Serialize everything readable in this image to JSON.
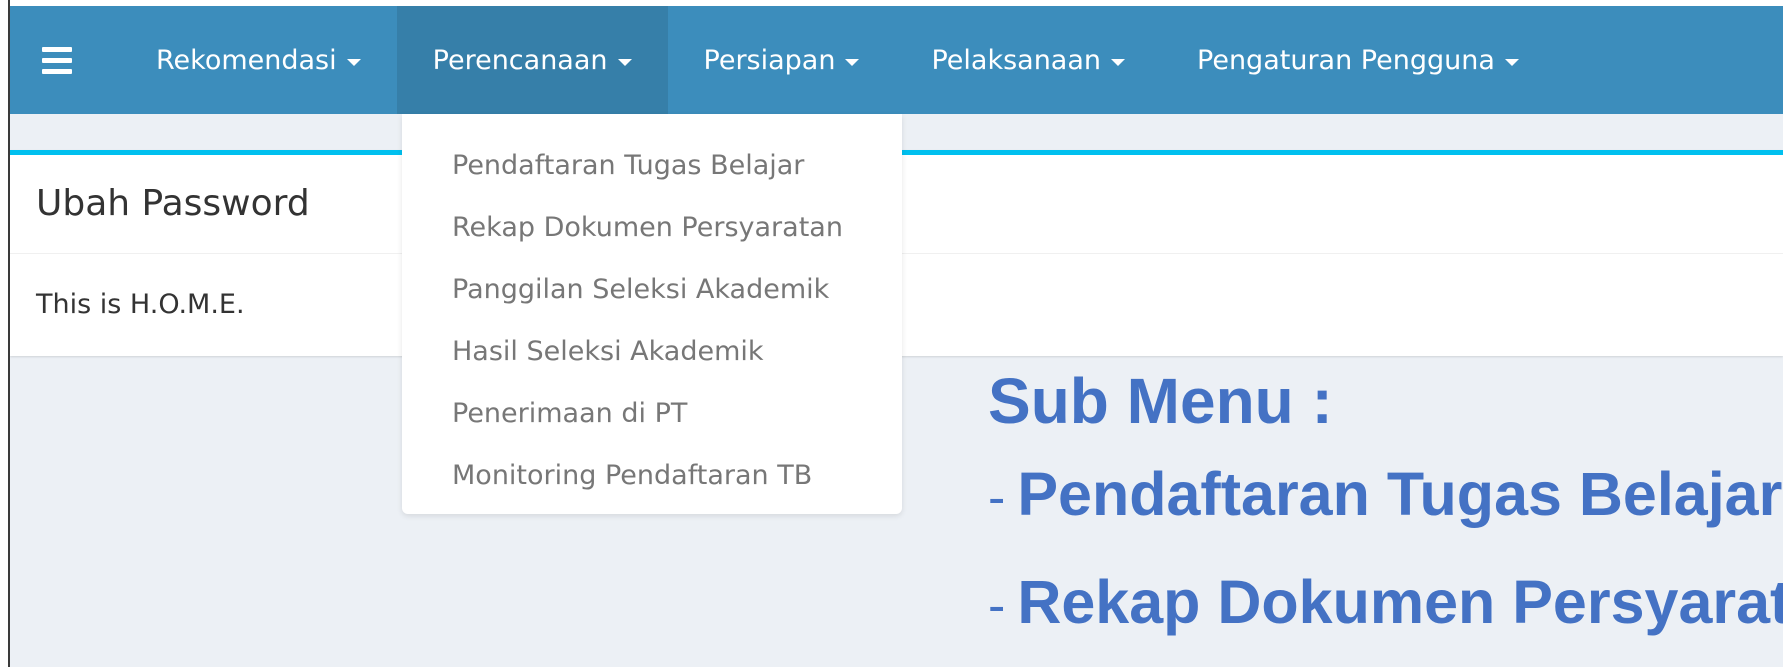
{
  "navbar": {
    "toggle_icon": "hamburger-icon",
    "items": [
      {
        "label": "Rekomendasi"
      },
      {
        "label": "Perencanaan"
      },
      {
        "label": "Persiapan"
      },
      {
        "label": "Pelaksanaan"
      },
      {
        "label": "Pengaturan Pengguna"
      }
    ],
    "active_index": 1,
    "color": "#3c8dbc",
    "active_color": "#367fa9"
  },
  "dropdown": {
    "items": [
      {
        "label": "Pendaftaran Tugas Belajar"
      },
      {
        "label": "Rekap Dokumen Persyaratan"
      },
      {
        "label": "Panggilan Seleksi Akademik"
      },
      {
        "label": "Hasil Seleksi Akademik"
      },
      {
        "label": "Penerimaan di PT"
      },
      {
        "label": "Monitoring Pendaftaran TB"
      }
    ]
  },
  "box": {
    "title": "Ubah Password",
    "body": "This is H.O.M.E.",
    "accent_color": "#00c0ef"
  },
  "annotation": {
    "title": "Sub Menu :",
    "lines": [
      {
        "dash": "-",
        "text": "Pendaftaran Tugas Belajar"
      },
      {
        "dash": "-",
        "text": "Rekap Dokumen Persyaratan"
      }
    ],
    "color": "#4472c4"
  }
}
